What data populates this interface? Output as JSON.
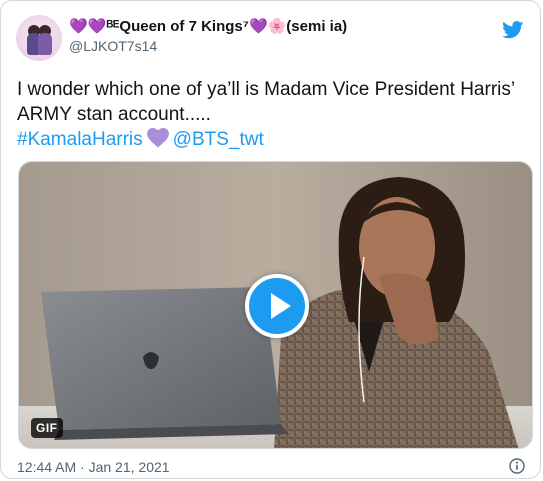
{
  "author": {
    "display_name": "💜💜ᴮᴱQueen of 7 Kings⁷💜🌸(semi ia)",
    "handle": "@LJKOT7s14"
  },
  "tweet": {
    "line1": "I wonder which one of ya’ll is Madam Vice President Harris’",
    "line2": "ARMY stan account.....",
    "hashtag": "#KamalaHarris",
    "mention": "@BTS_twt"
  },
  "media": {
    "badge": "GIF"
  },
  "meta": {
    "timestamp": "12:44 AM · Jan 21, 2021"
  },
  "icons": {
    "brand": "twitter-bird-icon",
    "heart": "purple-heart-icon",
    "play": "play-icon",
    "info": "info-icon"
  },
  "colors": {
    "brand_blue": "#1d9bf0",
    "text_primary": "#0f1419",
    "text_secondary": "#536471",
    "heart_purple": "#ab8ed8"
  }
}
